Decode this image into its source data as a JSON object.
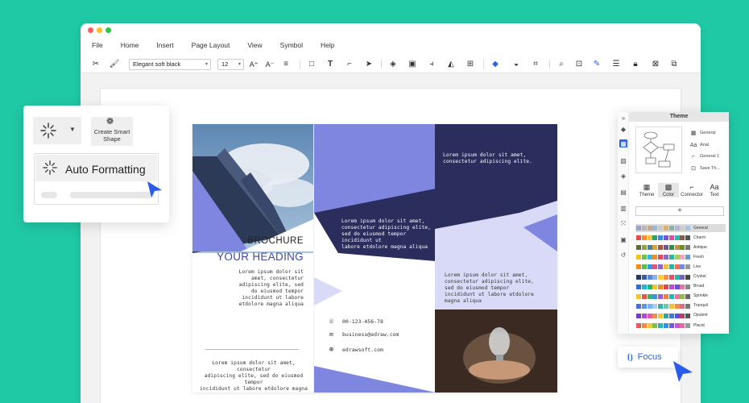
{
  "window": {
    "dots": [
      "#ff5f57",
      "#febc2e",
      "#28c840"
    ]
  },
  "menu": [
    "File",
    "Home",
    "Insert",
    "Page Layout",
    "View",
    "Symbol",
    "Help"
  ],
  "toolbar": {
    "font_name": "Elegant soft black",
    "font_size": "12"
  },
  "brochure": {
    "heading_small": "BROCHURE",
    "heading_main": "YOUR HEADING",
    "left_text": [
      "Lorem ipsum dolor sit",
      "amet, consectetur",
      "adipiscing elite, sed",
      "do eiusmod tempor",
      "incididunt ut labore",
      "etdolore magna aliqua"
    ],
    "footer_text": [
      "Lorem ipsum dolor sit amet, consectetur",
      "adipiscing elite, sed do eiusmod tempor",
      "incididunt ut labore etdolore magna aliqua"
    ],
    "center_text": [
      "Lorem ipsum dolor sit amet,",
      "consectetur adipiscing elite,",
      "sed do eiusmod tempor incididunt ut",
      "labore etdolore magna aliqua"
    ],
    "right_top_text": [
      "Lorem ipsum dolor sit amet,",
      "consectetur adipiscing elite."
    ],
    "right_mid_text": [
      "Lorem ipsum dolor sit amet,",
      "consectetur adipiscing elite,",
      "sed do eiusmod tempor",
      "incididunt ut labore etdolore",
      "magna aliqua"
    ],
    "phone": "00-123-456-78",
    "email": "business@edraw.com",
    "web": "edrawsoft.com"
  },
  "float": {
    "smart_shape": "Create Smart Shape",
    "auto_formatting": "Auto Formatting"
  },
  "side": {
    "title": "Theme",
    "options": [
      "General",
      "Arial",
      "General 1",
      "Save Th..."
    ],
    "tabs": [
      "Theme",
      "Color",
      "Connector",
      "Text"
    ],
    "plus": "+",
    "palettes": [
      {
        "name": "General",
        "colors": [
          "#9aa6c8",
          "#b7b7b7",
          "#c6a98c",
          "#9fb7d4",
          "#c9c9c9",
          "#e0b06b",
          "#8fb3a3",
          "#b4b4d6",
          "#ccc",
          "#a7c4e0"
        ]
      },
      {
        "name": "Charm",
        "colors": [
          "#e24d4d",
          "#ff8a2b",
          "#f7c33b",
          "#2fa06b",
          "#2f8fd8",
          "#7355d6",
          "#d94ea6",
          "#33b3b3",
          "#8a5a44",
          "#555"
        ]
      },
      {
        "name": "Antique",
        "colors": [
          "#5b6e3b",
          "#8ca24d",
          "#4f7f9a",
          "#d6a63b",
          "#a4583a",
          "#6c5b8e",
          "#2e8b57",
          "#c78b55",
          "#6b8e23",
          "#777"
        ]
      },
      {
        "name": "Fresh",
        "colors": [
          "#f0c419",
          "#6cc24a",
          "#3db8e6",
          "#f28b30",
          "#e84c5c",
          "#8a6cd1",
          "#2db39e",
          "#a3d15c",
          "#f4a6b7",
          "#69c"
        ]
      },
      {
        "name": "Live",
        "colors": [
          "#f58a1f",
          "#5dbb46",
          "#2d9fe0",
          "#ea4f7e",
          "#9260cf",
          "#f2c12e",
          "#20b6a6",
          "#ef6f4f",
          "#6d8be6",
          "#999"
        ]
      },
      {
        "name": "Crystal",
        "colors": [
          "#223a66",
          "#3b5aa6",
          "#5c86d6",
          "#8cb1ec",
          "#ffcc33",
          "#ff8c42",
          "#e94f64",
          "#2bb6a3",
          "#7a5ccc",
          "#444"
        ]
      },
      {
        "name": "Broad",
        "colors": [
          "#2f6ed6",
          "#20b3d6",
          "#25b37a",
          "#f3c52f",
          "#f08a33",
          "#e2474d",
          "#b84fd0",
          "#6a4fd8",
          "#ea6fa6",
          "#888"
        ]
      },
      {
        "name": "Sprinkle",
        "colors": [
          "#f5c32e",
          "#e9554d",
          "#3fb16a",
          "#3b94e0",
          "#9b5fd4",
          "#f07f3c",
          "#26b4b0",
          "#ed6fa4",
          "#8fbf3f",
          "#666"
        ]
      },
      {
        "name": "Tranquil",
        "colors": [
          "#4a6fd8",
          "#5f91e6",
          "#7cb2ee",
          "#a6cff2",
          "#3ab3a5",
          "#6cc7b1",
          "#f0c23a",
          "#ef8f4a",
          "#e36b7f",
          "#777"
        ]
      },
      {
        "name": "Opulent",
        "colors": [
          "#7a3cc6",
          "#b04bd0",
          "#e25aa9",
          "#f18d4a",
          "#f4c43a",
          "#2ea7a0",
          "#3b7ad6",
          "#5b4fd8",
          "#c23b5e",
          "#555"
        ]
      },
      {
        "name": "Placid",
        "colors": [
          "#e45b5b",
          "#f08c3a",
          "#f5c53c",
          "#7cc04b",
          "#35b3a8",
          "#3a8fe0",
          "#6a5fd8",
          "#c35bd0",
          "#e66aa0",
          "#999"
        ]
      }
    ]
  },
  "focus": {
    "label": "Focus"
  },
  "colors": {
    "background": "#20c9a6",
    "accent": "#3f46b5",
    "navy": "#2b2d5c",
    "periwinkle": "#7f86e0",
    "lavender": "#d8daf8",
    "cursor": "#2a5bea"
  }
}
